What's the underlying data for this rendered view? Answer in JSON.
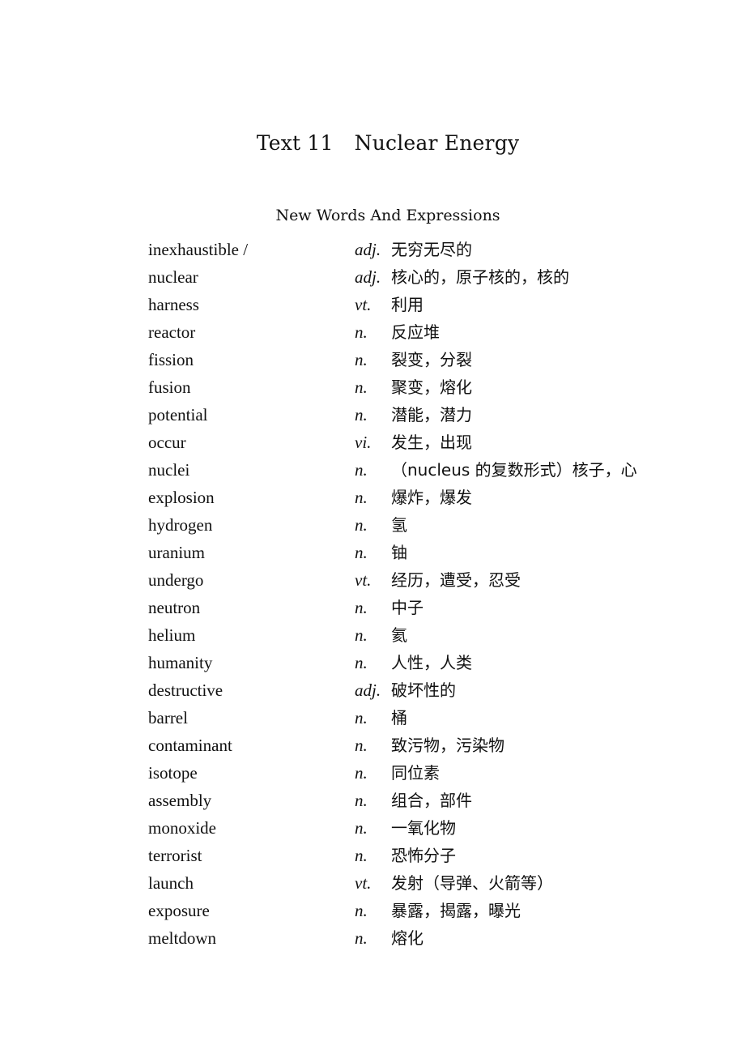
{
  "document": {
    "title_text": "Text 11",
    "title_topic": "Nuclear Energy",
    "subtitle": "New Words And Expressions",
    "vocabulary": [
      {
        "word": "inexhaustible /",
        "pos": "adj.",
        "meaning": "无穷无尽的"
      },
      {
        "word": "nuclear",
        "pos": "adj.",
        "meaning": "核心的，原子核的，核的"
      },
      {
        "word": "harness",
        "pos": "vt.",
        "meaning": "利用"
      },
      {
        "word": "reactor",
        "pos": "n.",
        "meaning": "反应堆"
      },
      {
        "word": "fission",
        "pos": "n.",
        "meaning": "裂变，分裂"
      },
      {
        "word": "fusion",
        "pos": "n.",
        "meaning": "聚变，熔化"
      },
      {
        "word": "potential",
        "pos": "n.",
        "meaning": "潜能，潜力"
      },
      {
        "word": "occur",
        "pos": "vi.",
        "meaning": "发生，出现"
      },
      {
        "word": "nuclei",
        "pos": "n.",
        "meaning": "（nucleus 的复数形式）核子，心"
      },
      {
        "word": "explosion",
        "pos": "n.",
        "meaning": "爆炸，爆发"
      },
      {
        "word": "hydrogen",
        "pos": "n.",
        "meaning": "氢"
      },
      {
        "word": "uranium",
        "pos": "n.",
        "meaning": "铀"
      },
      {
        "word": "undergo",
        "pos": "vt.",
        "meaning": "经历，遭受，忍受"
      },
      {
        "word": "neutron",
        "pos": "n.",
        "meaning": "中子"
      },
      {
        "word": "helium",
        "pos": "n.",
        "meaning": "氦"
      },
      {
        "word": "humanity",
        "pos": "n.",
        "meaning": "人性，人类"
      },
      {
        "word": "destructive",
        "pos": "adj.",
        "meaning": "破坏性的"
      },
      {
        "word": "barrel",
        "pos": "n.",
        "meaning": "桶"
      },
      {
        "word": "contaminant",
        "pos": "n.",
        "meaning": "致污物，污染物"
      },
      {
        "word": "isotope",
        "pos": "n.",
        "meaning": "同位素"
      },
      {
        "word": "assembly",
        "pos": "n.",
        "meaning": "组合，部件"
      },
      {
        "word": "monoxide",
        "pos": "n.",
        "meaning": "一氧化物"
      },
      {
        "word": "terrorist",
        "pos": "n.",
        "meaning": "恐怖分子"
      },
      {
        "word": "launch",
        "pos": "vt.",
        "meaning": "发射（导弹、火箭等）"
      },
      {
        "word": "exposure",
        "pos": "n.",
        "meaning": "暴露，揭露，曝光"
      },
      {
        "word": "meltdown",
        "pos": "n.",
        "meaning": "熔化"
      }
    ]
  }
}
